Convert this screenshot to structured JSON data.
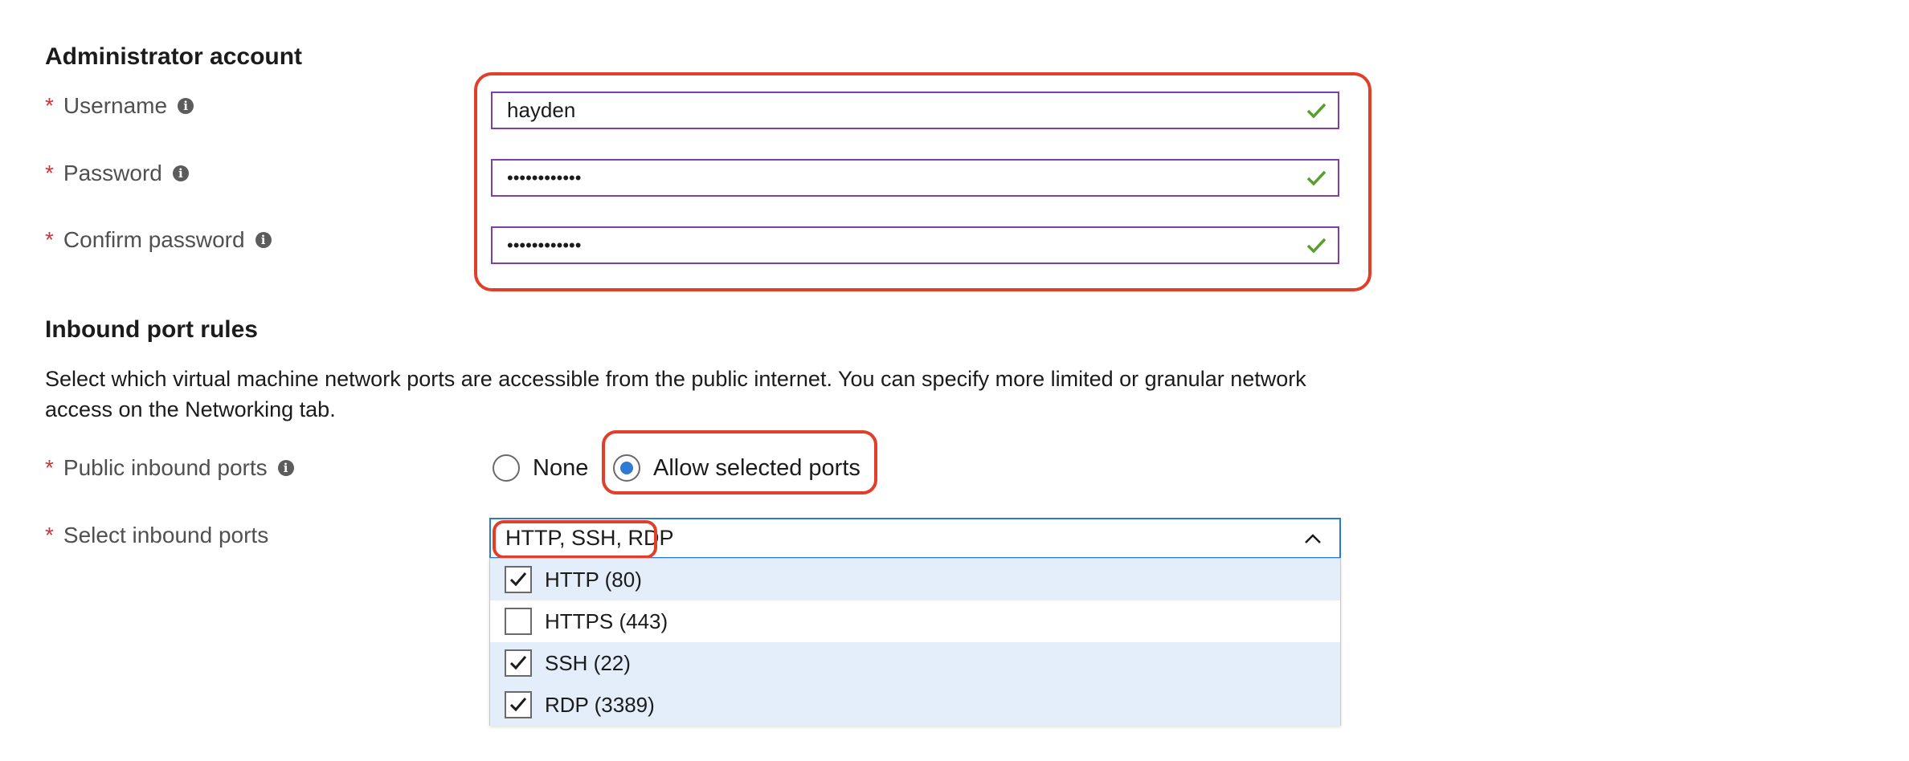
{
  "admin": {
    "title": "Administrator account",
    "username": {
      "label": "Username",
      "value": "hayden"
    },
    "password": {
      "label": "Password",
      "value": "••••••••••••"
    },
    "confirm": {
      "label": "Confirm password",
      "value": "••••••••••••"
    }
  },
  "inbound": {
    "title": "Inbound port rules",
    "description": "Select which virtual machine network ports are accessible from the public internet. You can specify more limited or granular network access on the Networking tab.",
    "public_ports": {
      "label": "Public inbound ports",
      "options": [
        {
          "label": "None",
          "selected": false
        },
        {
          "label": "Allow selected ports",
          "selected": true
        }
      ]
    },
    "select_ports": {
      "label": "Select inbound ports",
      "value": "HTTP, SSH, RDP",
      "options": [
        {
          "label": "HTTP (80)",
          "checked": true
        },
        {
          "label": "HTTPS (443)",
          "checked": false
        },
        {
          "label": "SSH (22)",
          "checked": true
        },
        {
          "label": "RDP (3389)",
          "checked": true
        }
      ]
    }
  },
  "colors": {
    "required": "#d13438",
    "field_border": "#7f3fa6",
    "valid_check": "#5a9e30",
    "dropdown_border": "#2b79d4",
    "radio_fill": "#2f7bd3",
    "checked_row": "#e3eefa",
    "callout": "#e23f2b"
  },
  "icons": {
    "info": "info-icon",
    "valid": "checkmark-icon",
    "dropdown": "chevron-up-icon",
    "checkbox": "checkbox-check-icon"
  }
}
